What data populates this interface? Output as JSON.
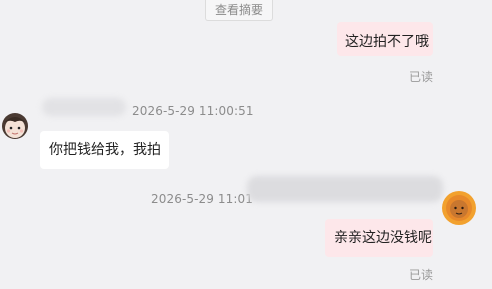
{
  "summary": {
    "label": "查看摘要"
  },
  "messages": [
    {
      "text": "这边拍不了哦",
      "status": "已读"
    },
    {
      "time": "2026-5-29 11:00:51",
      "text": "你把钱给我，我拍"
    },
    {
      "time": "2026-5-29 11:01",
      "text": "亲亲这边没钱呢",
      "status": "已读"
    }
  ],
  "colors": {
    "outgoing_bubble": "#fde7ea",
    "incoming_bubble": "#ffffff",
    "background": "#f1f1f3"
  }
}
